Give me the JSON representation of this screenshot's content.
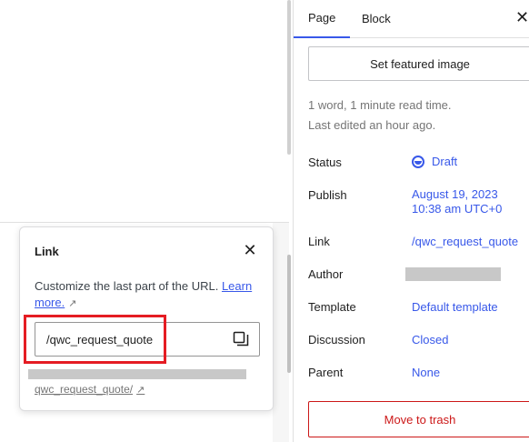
{
  "popover": {
    "title": "Link",
    "description": "Customize the last part of the URL.",
    "learn_more_label": "Learn more.",
    "external_glyph": "↗",
    "slug_value": "/qwc_request_quote",
    "permalink_text": "qwc_request_quote/",
    "close_icon": "close-icon",
    "copy_icon": "copy-icon"
  },
  "sidebar": {
    "tabs": [
      {
        "label": "Page",
        "active": true
      },
      {
        "label": "Block",
        "active": false
      }
    ],
    "close_glyph": "✕",
    "featured_image_label": "Set featured image",
    "read_time": "1 word, 1 minute read time.",
    "last_edited": "Last edited an hour ago.",
    "rows": {
      "status": {
        "label": "Status",
        "value": "Draft"
      },
      "publish": {
        "label": "Publish",
        "date": "August 19, 2023",
        "time": "10:38 am UTC+0"
      },
      "link": {
        "label": "Link",
        "value": "/qwc_request_quote"
      },
      "author": {
        "label": "Author"
      },
      "template": {
        "label": "Template",
        "value": "Default template"
      },
      "discussion": {
        "label": "Discussion",
        "value": "Closed"
      },
      "parent": {
        "label": "Parent",
        "value": "None"
      }
    },
    "trash_label": "Move to trash"
  },
  "colors": {
    "accent": "#3858e9",
    "danger": "#cc1818",
    "highlight": "#e51c23"
  }
}
